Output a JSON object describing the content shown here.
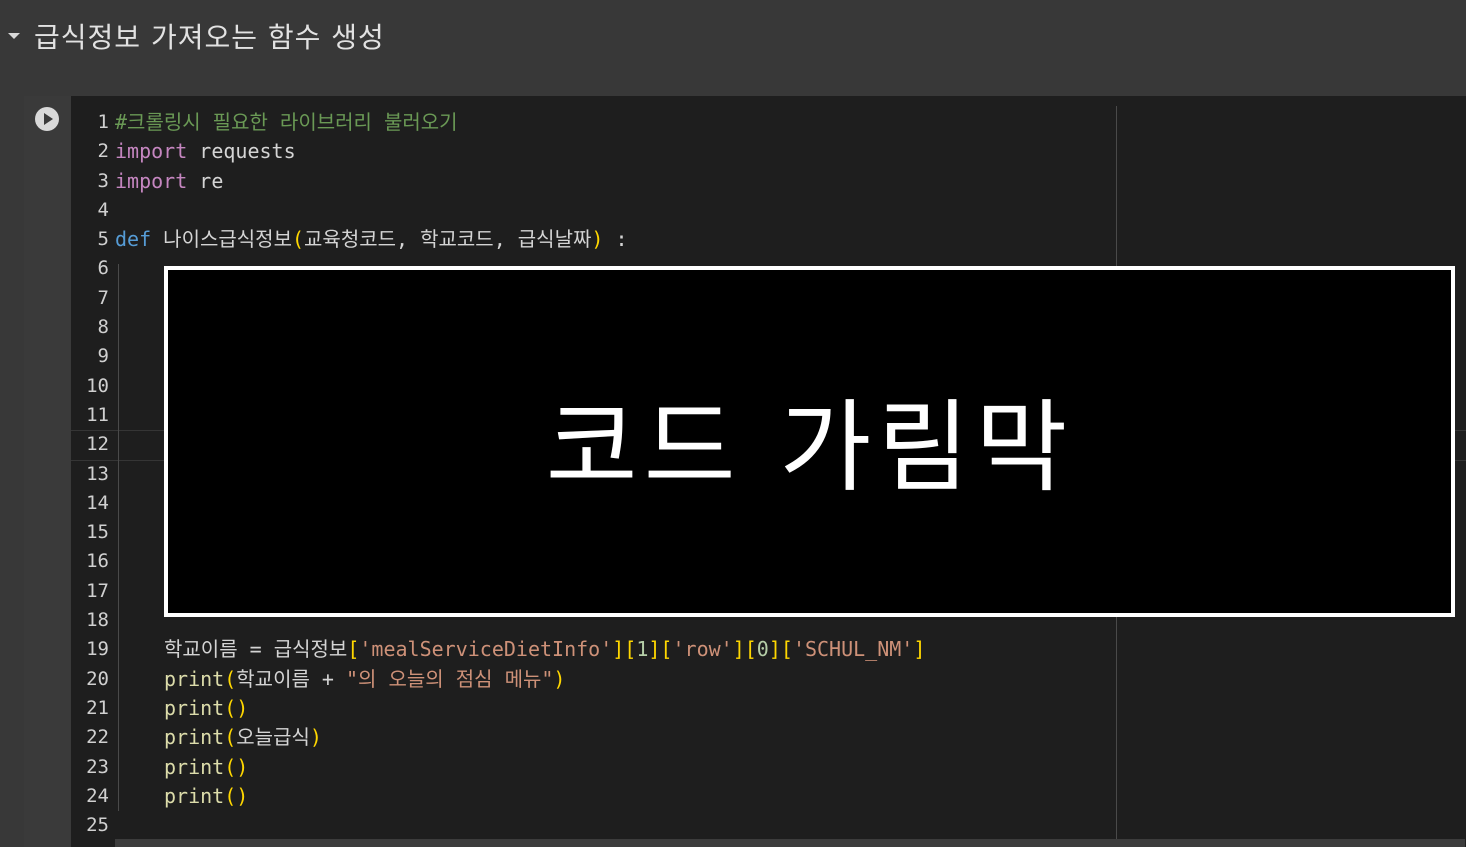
{
  "section": {
    "title": "급식정보 가져오는 함수 생성",
    "caret_icon": "caret-down-icon"
  },
  "cell": {
    "run_icon": "play-icon",
    "line_numbers": [
      "1",
      "2",
      "3",
      "4",
      "5",
      "6",
      "7",
      "8",
      "9",
      "10",
      "11",
      "12",
      "13",
      "14",
      "15",
      "16",
      "17",
      "18",
      "19",
      "20",
      "21",
      "22",
      "23",
      "24",
      "25"
    ],
    "code": {
      "l1_comment": "#크롤링시 필요한 라이브러리 불러오기",
      "l2_kw": "import",
      "l2_mod": " requests",
      "l3_kw": "import",
      "l3_mod": " re",
      "l5_kw": "def",
      "l5_name": " 나이스급식정보",
      "l5_open": "(",
      "l5_params": "교육청코드, 학교코드, 급식날짜",
      "l5_close": ")",
      "l5_colon": " :",
      "l19_a": "학교이름 = 급식정보",
      "l19_b1": "[",
      "l19_s1": "'mealServiceDietInfo'",
      "l19_b2": "][",
      "l19_n1": "1",
      "l19_b3": "][",
      "l19_s2": "'row'",
      "l19_b4": "][",
      "l19_n2": "0",
      "l19_b5": "][",
      "l19_s3": "'SCHUL_NM'",
      "l19_b6": "]",
      "l20_fn": "print",
      "l20_open": "(",
      "l20_arg": "학교이름 + ",
      "l20_str": "\"의 오늘의 점심 메뉴\"",
      "l20_close": ")",
      "l21_fn": "print",
      "l21_parens": "()",
      "l22_fn": "print",
      "l22_open": "(",
      "l22_arg": "오늘급식",
      "l22_close": ")",
      "l23_fn": "print",
      "l23_parens": "()",
      "l24_fn": "print",
      "l24_parens": "()"
    }
  },
  "overlay": {
    "text": "코드 가림막"
  },
  "colors": {
    "keyword": "#c586c0",
    "def_keyword": "#569cd6",
    "comment": "#6a9955",
    "string": "#ce9178",
    "number": "#b5cea8",
    "bracket": "#ffd700",
    "function": "#dcdcaa"
  }
}
